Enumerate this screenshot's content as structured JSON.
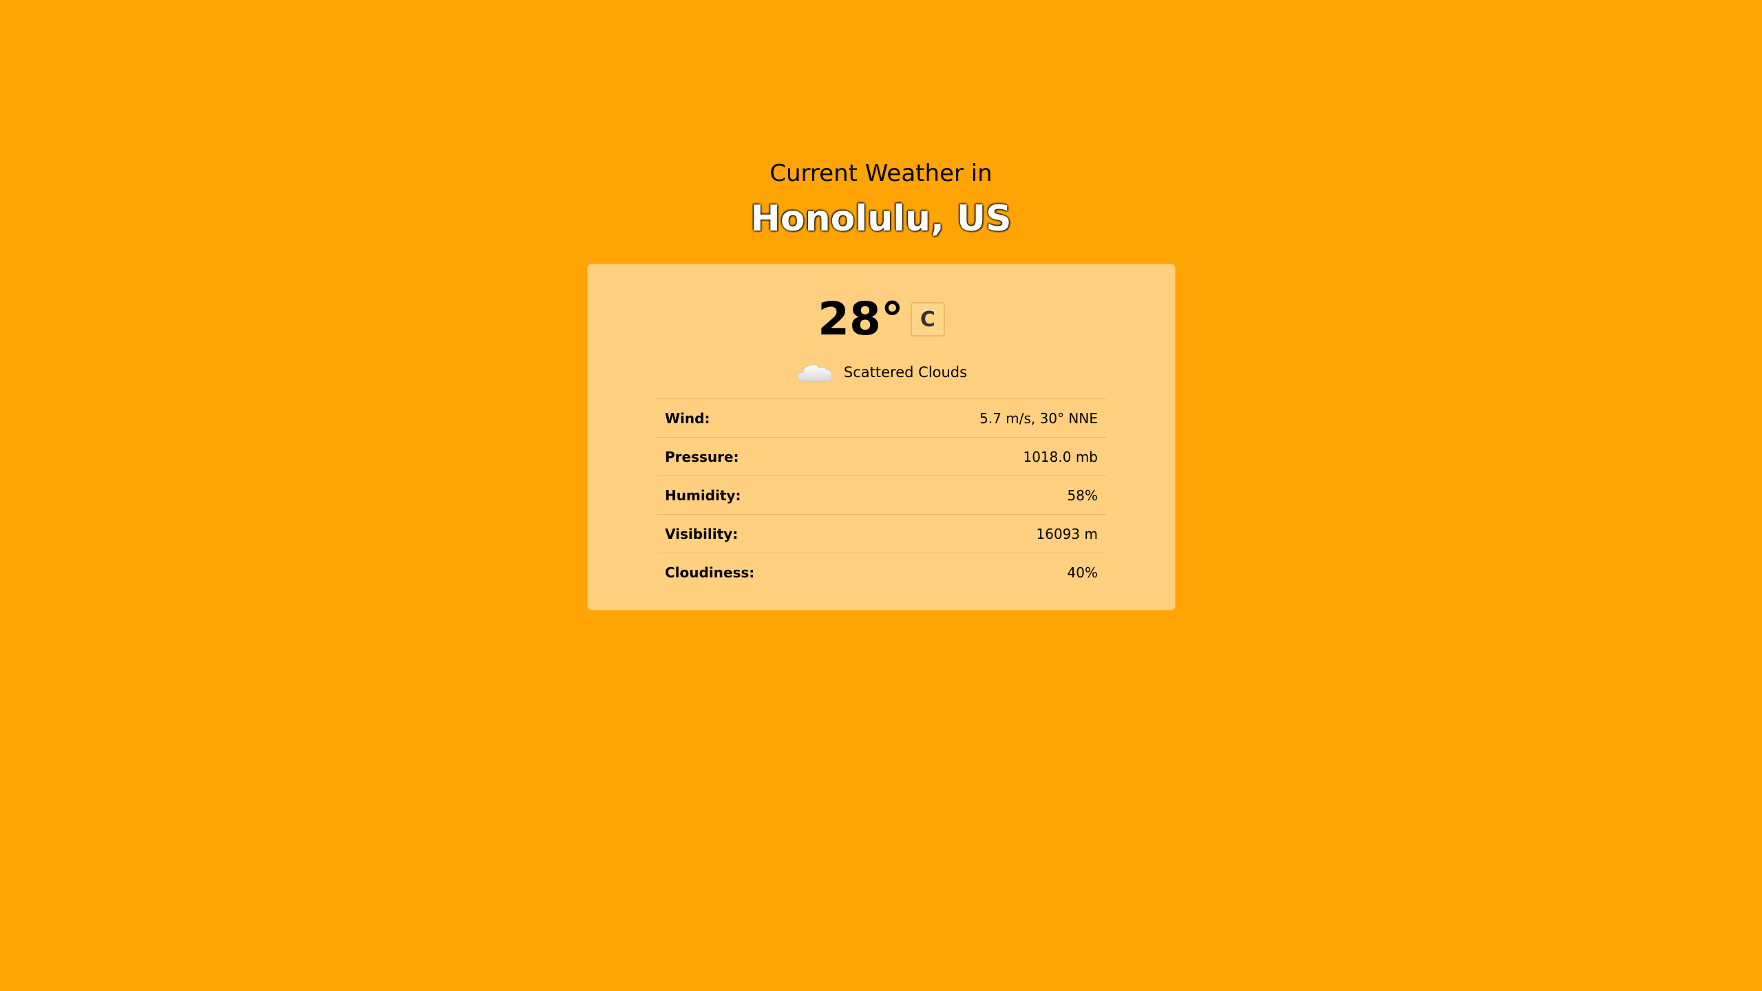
{
  "header": {
    "subtitle": "Current Weather in",
    "location": "Honolulu, US"
  },
  "current": {
    "temperature": "28°",
    "unit_button": "C",
    "condition": "Scattered Clouds",
    "condition_icon": "cloud-icon"
  },
  "details": [
    {
      "label": "Wind:",
      "value": "5.7 m/s, 30° NNE"
    },
    {
      "label": "Pressure:",
      "value": "1018.0 mb"
    },
    {
      "label": "Humidity:",
      "value": "58%"
    },
    {
      "label": "Visibility:",
      "value": "16093 m"
    },
    {
      "label": "Cloudiness:",
      "value": "40%"
    }
  ],
  "colors": {
    "background": "#ffa405",
    "card": "#ffd07f"
  }
}
